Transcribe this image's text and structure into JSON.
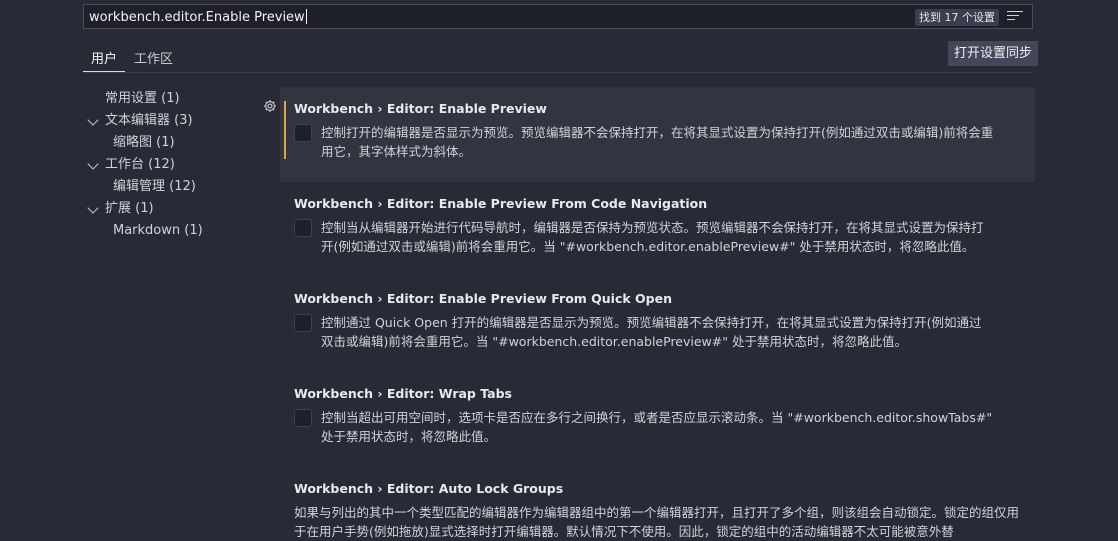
{
  "search": {
    "value": "workbench.editor.Enable Preview",
    "result_count": "找到 17 个设置"
  },
  "icons": {
    "filter": "filter-list-icon",
    "gear": "gear-icon",
    "chevron": "chevron-down-icon"
  },
  "tabs": [
    {
      "label": "用户",
      "active": true
    },
    {
      "label": "工作区",
      "active": false
    }
  ],
  "sync_button": "打开设置同步",
  "toc": [
    {
      "label": "常用设置 (1)",
      "level": 1,
      "expandable": false
    },
    {
      "label": "文本编辑器 (3)",
      "level": 1,
      "expandable": true
    },
    {
      "label": "缩略图 (1)",
      "level": 2,
      "expandable": false
    },
    {
      "label": "工作台 (12)",
      "level": 1,
      "expandable": true
    },
    {
      "label": "编辑管理 (12)",
      "level": 2,
      "expandable": false
    },
    {
      "label": "扩展 (1)",
      "level": 1,
      "expandable": true
    },
    {
      "label": "Markdown (1)",
      "level": 2,
      "expandable": false
    }
  ],
  "settings": [
    {
      "title": "Workbench › Editor: Enable Preview",
      "description": "控制打开的编辑器是否显示为预览。预览编辑器不会保持打开，在将其显式设置为保持打开(例如通过双击或编辑)前将会重用它，其字体样式为斜体。",
      "checked": false
    },
    {
      "title": "Workbench › Editor: Enable Preview From Code Navigation",
      "description": "控制当从编辑器开始进行代码导航时，编辑器是否保持为预览状态。预览编辑器不会保持打开，在将其显式设置为保持打开(例如通过双击或编辑)前将会重用它。当 \"#workbench.editor.enablePreview#\" 处于禁用状态时，将忽略此值。",
      "checked": false
    },
    {
      "title": "Workbench › Editor: Enable Preview From Quick Open",
      "description": "控制通过 Quick Open 打开的编辑器是否显示为预览。预览编辑器不会保持打开，在将其显式设置为保持打开(例如通过双击或编辑)前将会重用它。当 \"#workbench.editor.enablePreview#\" 处于禁用状态时，将忽略此值。",
      "checked": false
    },
    {
      "title": "Workbench › Editor: Wrap Tabs",
      "description": "控制当超出可用空间时，选项卡是否应在多行之间换行，或者是否应显示滚动条。当 \"#workbench.editor.showTabs#\" 处于禁用状态时，将忽略此值。",
      "checked": false
    },
    {
      "title": "Workbench › Editor: Auto Lock Groups",
      "description": "如果与列出的其中一个类型匹配的编辑器作为编辑器组中的第一个编辑器打开，且打开了多个组，则该组会自动锁定。锁定的组仅用于在用户手势(例如拖放)显式选择时打开编辑器。默认情况下不使用。因此，锁定的组中的活动编辑器不太可能被意外替"
    }
  ]
}
